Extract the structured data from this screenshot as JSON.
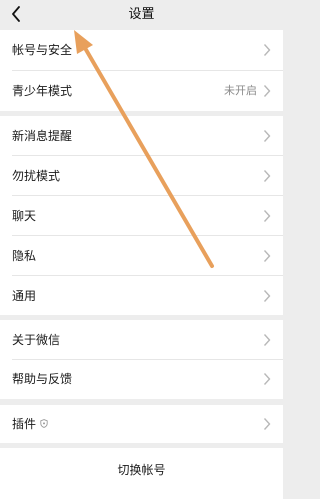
{
  "header": {
    "title": "设置"
  },
  "groups": [
    {
      "items": [
        {
          "label": "帐号与安全",
          "value": ""
        },
        {
          "label": "青少年模式",
          "value": "未开启"
        }
      ]
    },
    {
      "items": [
        {
          "label": "新消息提醒",
          "value": ""
        },
        {
          "label": "勿扰模式",
          "value": ""
        },
        {
          "label": "聊天",
          "value": ""
        },
        {
          "label": "隐私",
          "value": ""
        },
        {
          "label": "通用",
          "value": ""
        }
      ]
    },
    {
      "items": [
        {
          "label": "关于微信",
          "value": ""
        },
        {
          "label": "帮助与反馈",
          "value": ""
        }
      ]
    },
    {
      "items": [
        {
          "label": "插件",
          "value": ""
        }
      ]
    }
  ],
  "switch_account": {
    "label": "切换帐号"
  },
  "colors": {
    "background": "#ededed",
    "row": "#ffffff",
    "annotation_arrow": "#e8a05c"
  },
  "icons": {
    "back": "back-arrow-icon",
    "chevron": "chevron-right-icon",
    "plugin_badge": "shield-icon"
  }
}
